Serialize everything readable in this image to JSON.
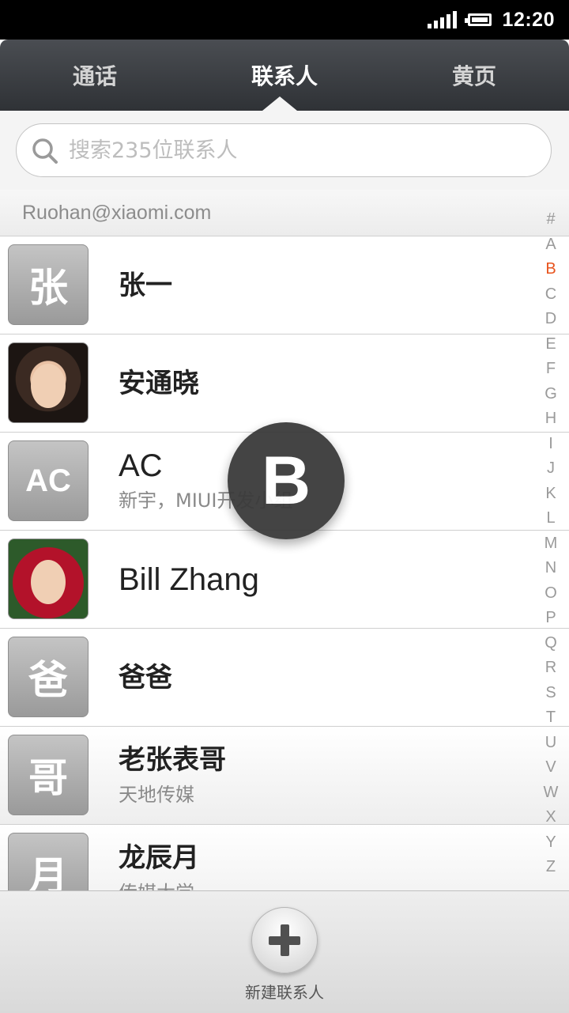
{
  "status_bar": {
    "time": "12:20"
  },
  "tabs": [
    {
      "label": "通话",
      "active": false
    },
    {
      "label": "联系人",
      "active": true
    },
    {
      "label": "黄页",
      "active": false
    }
  ],
  "search": {
    "placeholder": "搜索235位联系人"
  },
  "account": {
    "label": "Ruohan@xiaomi.com"
  },
  "contacts": [
    {
      "avatar_text": "张",
      "name": "张一",
      "subtitle": ""
    },
    {
      "avatar_text": "",
      "name": "安通晓",
      "subtitle": ""
    },
    {
      "avatar_text": "AC",
      "name": "AC",
      "subtitle": "新宇，MIUI开发小组"
    },
    {
      "avatar_text": "",
      "name": "Bill Zhang",
      "subtitle": ""
    },
    {
      "avatar_text": "爸",
      "name": "爸爸",
      "subtitle": ""
    },
    {
      "avatar_text": "哥",
      "name": "老张表哥",
      "subtitle": "天地传媒"
    },
    {
      "avatar_text": "月",
      "name": "龙辰月",
      "subtitle": "传媒大学"
    }
  ],
  "index": {
    "letters": [
      "#",
      "A",
      "B",
      "C",
      "D",
      "E",
      "F",
      "G",
      "H",
      "I",
      "J",
      "K",
      "L",
      "M",
      "N",
      "O",
      "P",
      "Q",
      "R",
      "S",
      "T",
      "U",
      "V",
      "W",
      "X",
      "Y",
      "Z"
    ],
    "active": "B"
  },
  "overlay_letter": "B",
  "bottom_bar": {
    "add_label": "新建联系人"
  },
  "colors": {
    "accent": "#e8541e",
    "tab_bg": "#3a3d41"
  }
}
